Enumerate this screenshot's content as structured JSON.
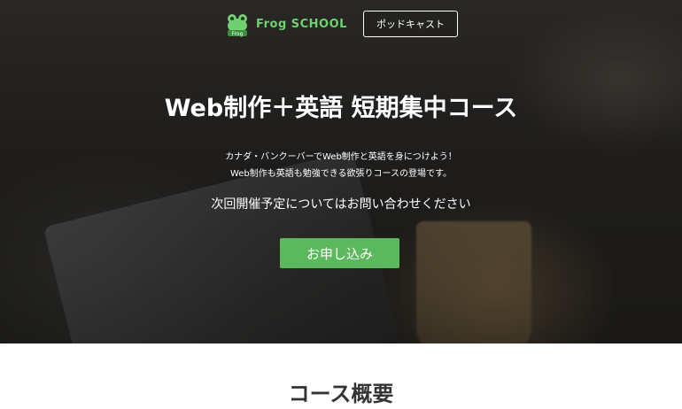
{
  "header": {
    "logo_text": "Frog SCHOOL",
    "logo_badge": "Frog",
    "podcast_label": "ポッドキャスト"
  },
  "hero": {
    "title": "Web制作＋英語 短期集中コース",
    "description_lines": [
      "カナダ・バンクーバーでWeb制作と英語を身につけよう！",
      "Web制作も英語も勉強できる欲張りコースの登場です。"
    ],
    "notice": "次回開催予定についてはお問い合わせください",
    "apply_label": "お申し込み"
  },
  "section": {
    "title": "コース概要"
  },
  "colors": {
    "accent": "#5cb85c",
    "logo_green": "#6fd06f"
  },
  "icons": {
    "logo": "frog-icon"
  }
}
